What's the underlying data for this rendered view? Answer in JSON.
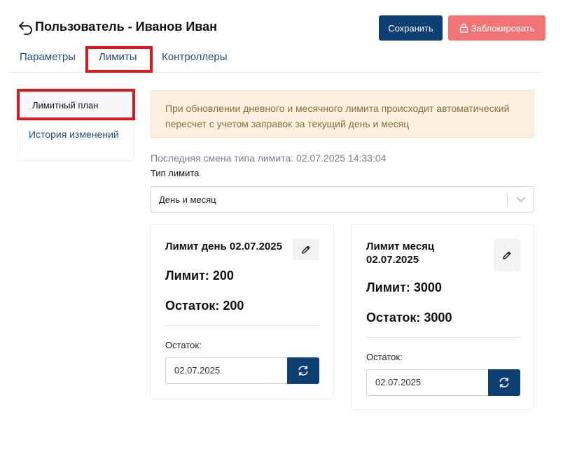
{
  "header": {
    "title": "Пользователь - Иванов Иван",
    "save_label": "Сохранить",
    "block_label": "Заблокировать"
  },
  "tabs": [
    {
      "label": "Параметры"
    },
    {
      "label": "Лимиты",
      "active": true
    },
    {
      "label": "Контроллеры"
    }
  ],
  "sidebar": {
    "items": [
      {
        "label": "Лимитный план",
        "active": true
      },
      {
        "label": "История изменений"
      }
    ]
  },
  "alert": {
    "text": "При обновлении дневного и месячного лимита происходит автоматический пересчет с учетом заправок за текущий день и месяц"
  },
  "limit_type": {
    "last_change": "Последняя смена типа лимита: 02.07.2025 14:33:04",
    "label": "Тип лимита",
    "value": "День и месяц"
  },
  "cards": {
    "day": {
      "title": "Лимит день 02.07.2025",
      "limit": "Лимит: 200",
      "remainder": "Остаток: 200",
      "rest_label": "Остаток:",
      "date": "02.07.2025"
    },
    "month": {
      "title": "Лимит месяц 02.07.2025",
      "limit": "Лимит: 3000",
      "remainder": "Остаток: 3000",
      "rest_label": "Остаток:",
      "date": "02.07.2025"
    }
  },
  "colors": {
    "primary": "#0d3f73",
    "danger": "#f07474",
    "highlight": "#e0161c",
    "alert_bg": "#fcf1e0",
    "alert_text": "#8a6d3b",
    "link": "#1f4e7c"
  },
  "icons": {
    "back": "back-arrow-icon",
    "lock": "lock-icon",
    "chevron": "chevron-down-icon",
    "edit": "pencil-icon",
    "refresh": "refresh-icon"
  }
}
